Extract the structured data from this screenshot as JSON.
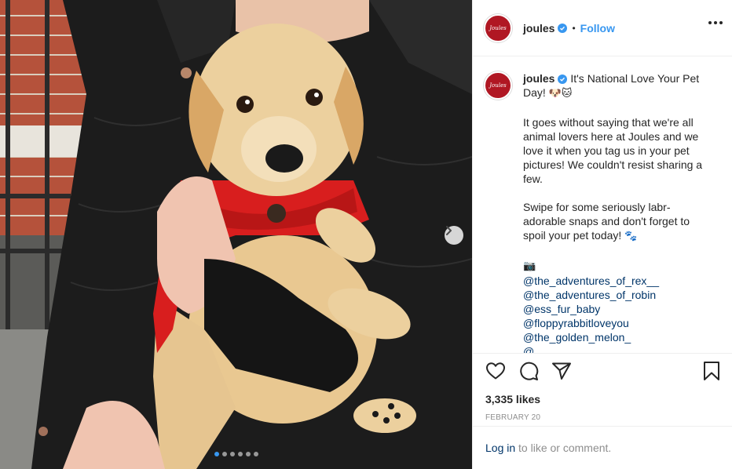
{
  "post": {
    "account": {
      "username": "joules",
      "avatar_text": "Joules",
      "verified": true,
      "separator": "•",
      "follow_label": "Follow"
    },
    "caption": {
      "line1": "It's National Love Your Pet Day!",
      "line1_emojis": "🐶🐱",
      "para2": "It goes without saying that we're all animal lovers here at Joules and we love it when you tag us in your pet pictures! We couldn't resist sharing a few.",
      "para3": "Swipe for some seriously labr-adorable snaps and don't forget to spoil your pet today!",
      "para3_emoji": "🐾",
      "camera_emoji": "📷",
      "mentions": [
        "@the_adventures_of_rex__",
        "@the_adventures_of_robin",
        "@ess_fur_baby",
        "@floppyrabbitloveyou",
        "@the_golden_melon_",
        "@..."
      ]
    },
    "likes": "3,335 likes",
    "date": "FEBRUARY 20",
    "login": {
      "link": "Log in",
      "rest": " to like or comment."
    },
    "carousel": {
      "slide_count": 6,
      "active_index": 0
    }
  },
  "icons": {
    "like": "heart-icon",
    "comment": "comment-icon",
    "share": "paper-plane-icon",
    "save": "bookmark-icon",
    "more": "more-dots-icon",
    "next": "chevron-right-icon",
    "verified": "verified-badge-icon"
  },
  "colors": {
    "accent": "#3897f0",
    "brand": "#b01723",
    "link": "#003569",
    "muted": "#8e8e8e",
    "jacket_red": "#d81e1e"
  }
}
